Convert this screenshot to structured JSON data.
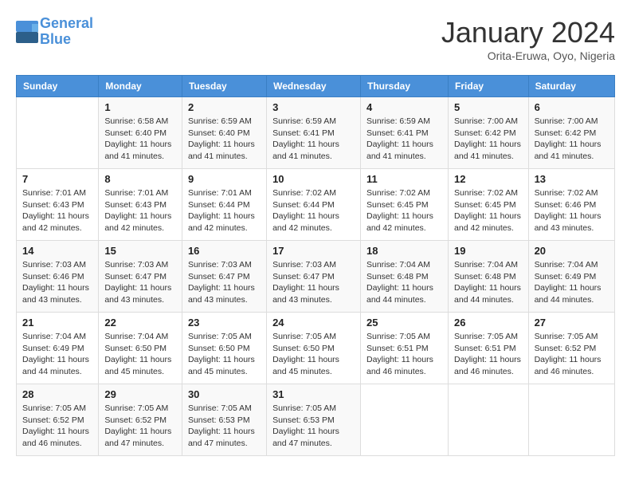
{
  "header": {
    "logo_line1": "General",
    "logo_line2": "Blue",
    "month": "January 2024",
    "location": "Orita-Eruwa, Oyo, Nigeria"
  },
  "weekdays": [
    "Sunday",
    "Monday",
    "Tuesday",
    "Wednesday",
    "Thursday",
    "Friday",
    "Saturday"
  ],
  "weeks": [
    [
      {
        "day": "",
        "sunrise": "",
        "sunset": "",
        "daylight": ""
      },
      {
        "day": "1",
        "sunrise": "Sunrise: 6:58 AM",
        "sunset": "Sunset: 6:40 PM",
        "daylight": "Daylight: 11 hours and 41 minutes."
      },
      {
        "day": "2",
        "sunrise": "Sunrise: 6:59 AM",
        "sunset": "Sunset: 6:40 PM",
        "daylight": "Daylight: 11 hours and 41 minutes."
      },
      {
        "day": "3",
        "sunrise": "Sunrise: 6:59 AM",
        "sunset": "Sunset: 6:41 PM",
        "daylight": "Daylight: 11 hours and 41 minutes."
      },
      {
        "day": "4",
        "sunrise": "Sunrise: 6:59 AM",
        "sunset": "Sunset: 6:41 PM",
        "daylight": "Daylight: 11 hours and 41 minutes."
      },
      {
        "day": "5",
        "sunrise": "Sunrise: 7:00 AM",
        "sunset": "Sunset: 6:42 PM",
        "daylight": "Daylight: 11 hours and 41 minutes."
      },
      {
        "day": "6",
        "sunrise": "Sunrise: 7:00 AM",
        "sunset": "Sunset: 6:42 PM",
        "daylight": "Daylight: 11 hours and 41 minutes."
      }
    ],
    [
      {
        "day": "7",
        "sunrise": "Sunrise: 7:01 AM",
        "sunset": "Sunset: 6:43 PM",
        "daylight": "Daylight: 11 hours and 42 minutes."
      },
      {
        "day": "8",
        "sunrise": "Sunrise: 7:01 AM",
        "sunset": "Sunset: 6:43 PM",
        "daylight": "Daylight: 11 hours and 42 minutes."
      },
      {
        "day": "9",
        "sunrise": "Sunrise: 7:01 AM",
        "sunset": "Sunset: 6:44 PM",
        "daylight": "Daylight: 11 hours and 42 minutes."
      },
      {
        "day": "10",
        "sunrise": "Sunrise: 7:02 AM",
        "sunset": "Sunset: 6:44 PM",
        "daylight": "Daylight: 11 hours and 42 minutes."
      },
      {
        "day": "11",
        "sunrise": "Sunrise: 7:02 AM",
        "sunset": "Sunset: 6:45 PM",
        "daylight": "Daylight: 11 hours and 42 minutes."
      },
      {
        "day": "12",
        "sunrise": "Sunrise: 7:02 AM",
        "sunset": "Sunset: 6:45 PM",
        "daylight": "Daylight: 11 hours and 42 minutes."
      },
      {
        "day": "13",
        "sunrise": "Sunrise: 7:02 AM",
        "sunset": "Sunset: 6:46 PM",
        "daylight": "Daylight: 11 hours and 43 minutes."
      }
    ],
    [
      {
        "day": "14",
        "sunrise": "Sunrise: 7:03 AM",
        "sunset": "Sunset: 6:46 PM",
        "daylight": "Daylight: 11 hours and 43 minutes."
      },
      {
        "day": "15",
        "sunrise": "Sunrise: 7:03 AM",
        "sunset": "Sunset: 6:47 PM",
        "daylight": "Daylight: 11 hours and 43 minutes."
      },
      {
        "day": "16",
        "sunrise": "Sunrise: 7:03 AM",
        "sunset": "Sunset: 6:47 PM",
        "daylight": "Daylight: 11 hours and 43 minutes."
      },
      {
        "day": "17",
        "sunrise": "Sunrise: 7:03 AM",
        "sunset": "Sunset: 6:47 PM",
        "daylight": "Daylight: 11 hours and 43 minutes."
      },
      {
        "day": "18",
        "sunrise": "Sunrise: 7:04 AM",
        "sunset": "Sunset: 6:48 PM",
        "daylight": "Daylight: 11 hours and 44 minutes."
      },
      {
        "day": "19",
        "sunrise": "Sunrise: 7:04 AM",
        "sunset": "Sunset: 6:48 PM",
        "daylight": "Daylight: 11 hours and 44 minutes."
      },
      {
        "day": "20",
        "sunrise": "Sunrise: 7:04 AM",
        "sunset": "Sunset: 6:49 PM",
        "daylight": "Daylight: 11 hours and 44 minutes."
      }
    ],
    [
      {
        "day": "21",
        "sunrise": "Sunrise: 7:04 AM",
        "sunset": "Sunset: 6:49 PM",
        "daylight": "Daylight: 11 hours and 44 minutes."
      },
      {
        "day": "22",
        "sunrise": "Sunrise: 7:04 AM",
        "sunset": "Sunset: 6:50 PM",
        "daylight": "Daylight: 11 hours and 45 minutes."
      },
      {
        "day": "23",
        "sunrise": "Sunrise: 7:05 AM",
        "sunset": "Sunset: 6:50 PM",
        "daylight": "Daylight: 11 hours and 45 minutes."
      },
      {
        "day": "24",
        "sunrise": "Sunrise: 7:05 AM",
        "sunset": "Sunset: 6:50 PM",
        "daylight": "Daylight: 11 hours and 45 minutes."
      },
      {
        "day": "25",
        "sunrise": "Sunrise: 7:05 AM",
        "sunset": "Sunset: 6:51 PM",
        "daylight": "Daylight: 11 hours and 46 minutes."
      },
      {
        "day": "26",
        "sunrise": "Sunrise: 7:05 AM",
        "sunset": "Sunset: 6:51 PM",
        "daylight": "Daylight: 11 hours and 46 minutes."
      },
      {
        "day": "27",
        "sunrise": "Sunrise: 7:05 AM",
        "sunset": "Sunset: 6:52 PM",
        "daylight": "Daylight: 11 hours and 46 minutes."
      }
    ],
    [
      {
        "day": "28",
        "sunrise": "Sunrise: 7:05 AM",
        "sunset": "Sunset: 6:52 PM",
        "daylight": "Daylight: 11 hours and 46 minutes."
      },
      {
        "day": "29",
        "sunrise": "Sunrise: 7:05 AM",
        "sunset": "Sunset: 6:52 PM",
        "daylight": "Daylight: 11 hours and 47 minutes."
      },
      {
        "day": "30",
        "sunrise": "Sunrise: 7:05 AM",
        "sunset": "Sunset: 6:53 PM",
        "daylight": "Daylight: 11 hours and 47 minutes."
      },
      {
        "day": "31",
        "sunrise": "Sunrise: 7:05 AM",
        "sunset": "Sunset: 6:53 PM",
        "daylight": "Daylight: 11 hours and 47 minutes."
      },
      {
        "day": "",
        "sunrise": "",
        "sunset": "",
        "daylight": ""
      },
      {
        "day": "",
        "sunrise": "",
        "sunset": "",
        "daylight": ""
      },
      {
        "day": "",
        "sunrise": "",
        "sunset": "",
        "daylight": ""
      }
    ]
  ]
}
